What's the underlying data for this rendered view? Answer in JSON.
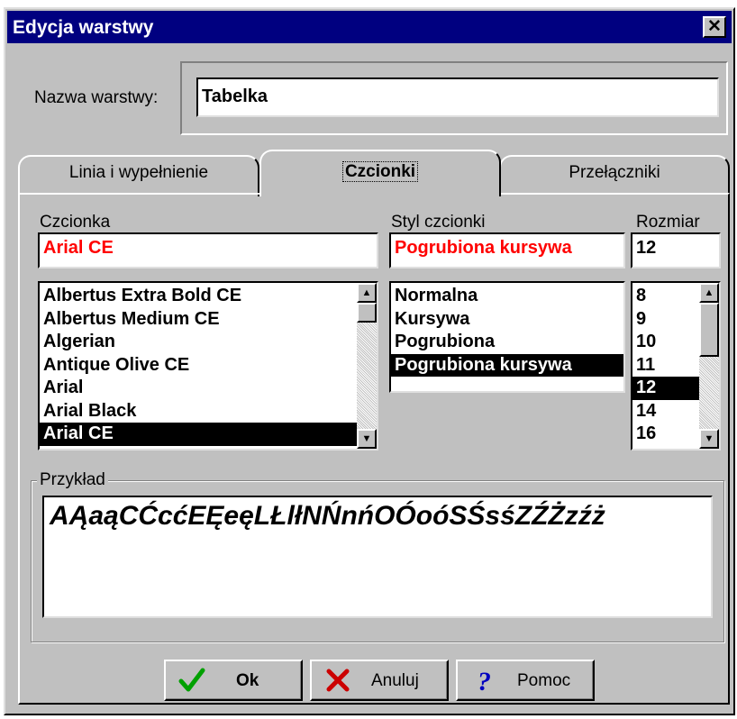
{
  "window": {
    "title": "Edycja warstwy",
    "close_label": "✕"
  },
  "layer_name": {
    "label": "Nazwa warstwy:",
    "value": "Tabelka"
  },
  "tabs": [
    {
      "label": "Linia i wypełnienie",
      "active": false
    },
    {
      "label": "Czcionki",
      "active": true
    },
    {
      "label": "Przełączniki",
      "active": false
    }
  ],
  "font": {
    "label": "Czcionka",
    "value": "Arial CE",
    "value_color": "#ff0000",
    "items": [
      "Albertus Extra Bold CE",
      "Albertus Medium CE",
      "Algerian",
      "Antique Olive CE",
      "Arial",
      "Arial Black",
      "Arial CE"
    ],
    "selected_index": 6
  },
  "style": {
    "label": "Styl czcionki",
    "value": "Pogrubiona kursywa",
    "value_color": "#ff0000",
    "items": [
      "Normalna",
      "Kursywa",
      "Pogrubiona",
      "Pogrubiona kursywa"
    ],
    "selected_index": 3
  },
  "size": {
    "label": "Rozmiar",
    "value": "12",
    "items": [
      "8",
      "9",
      "10",
      "11",
      "12",
      "14",
      "16"
    ],
    "selected_index": 4
  },
  "sample": {
    "label": "Przykład",
    "text": "AĄaąCĆcćEĘeęLŁlłNŃnńOÓoóSŚsśZŹŻzźż"
  },
  "buttons": {
    "ok": "Ok",
    "cancel": "Anuluj",
    "help": "Pomoc"
  },
  "colors": {
    "title_bar": "#000080",
    "face": "#c0c0c0",
    "selection": "#000000",
    "accent_red": "#ff0000",
    "ok_green": "#00a000",
    "help_blue": "#0000c0"
  }
}
